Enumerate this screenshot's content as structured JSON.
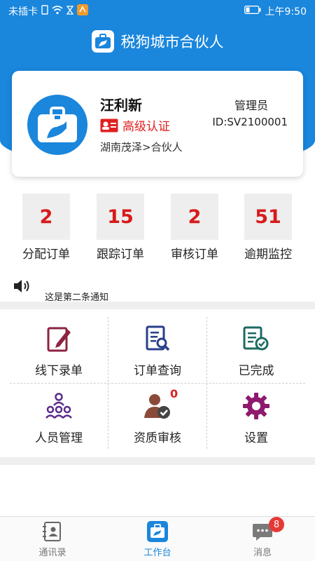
{
  "status_bar": {
    "carrier": "未插卡",
    "time": "上午9:50"
  },
  "header": {
    "title": "税狗城市合伙人"
  },
  "profile": {
    "name": "汪利新",
    "certification": "高级认证",
    "region": "湖南茂泽>合伙人",
    "role": "管理员",
    "id": "ID:SV2100001"
  },
  "stats": [
    {
      "value": "2",
      "label": "分配订单"
    },
    {
      "value": "15",
      "label": "跟踪订单"
    },
    {
      "value": "2",
      "label": "审核订单"
    },
    {
      "value": "51",
      "label": "逾期监控"
    }
  ],
  "notice": {
    "text": "这是第二条通知"
  },
  "menu": [
    {
      "label": "线下录单",
      "icon": "edit-document-icon"
    },
    {
      "label": "订单查询",
      "icon": "document-search-icon"
    },
    {
      "label": "已完成",
      "icon": "document-check-icon"
    },
    {
      "label": "人员管理",
      "icon": "people-group-icon"
    },
    {
      "label": "资质审核",
      "icon": "user-check-icon",
      "badge": "0"
    },
    {
      "label": "设置",
      "icon": "gear-icon"
    }
  ],
  "tabbar": {
    "items": [
      {
        "label": "通讯录",
        "icon": "contacts-icon"
      },
      {
        "label": "工作台",
        "icon": "workbench-icon"
      },
      {
        "label": "消息",
        "icon": "message-icon",
        "badge": "8"
      }
    ]
  },
  "colors": {
    "brand_blue": "#1a86dc",
    "stat_red": "#d81b1b",
    "cert_red": "#e02020",
    "icon_maroon": "#8e2340",
    "icon_navy": "#2a3f8a",
    "icon_teal": "#1d6b63",
    "icon_purple": "#5b2b8c",
    "icon_brown": "#8a4a3a",
    "icon_magenta": "#8e1a6e"
  }
}
